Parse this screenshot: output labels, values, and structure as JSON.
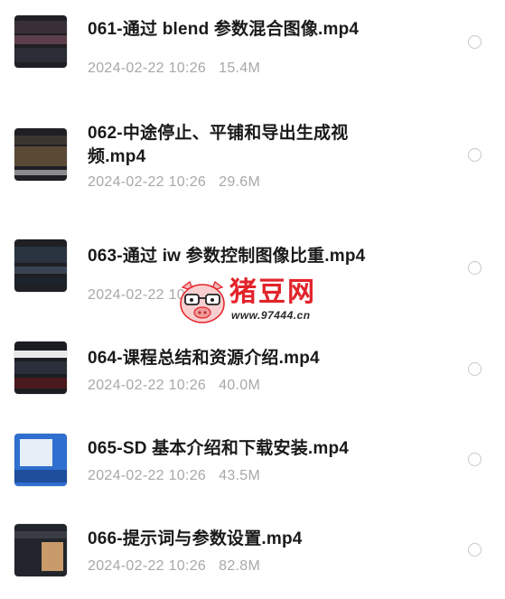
{
  "files": [
    {
      "name": "061-通过 blend 参数混合图像.mp4",
      "date": "2024-02-22 10:26",
      "size": "15.4M"
    },
    {
      "name": "062-中途停止、平铺和导出生成视频.mp4",
      "date": "2024-02-22 10:26",
      "size": "29.6M"
    },
    {
      "name": "063-通过 iw 参数控制图像比重.mp4",
      "date": "2024-02-22 10:26",
      "size": ""
    },
    {
      "name": "064-课程总结和资源介绍.mp4",
      "date": "2024-02-22 10:26",
      "size": "40.0M"
    },
    {
      "name": "065-SD 基本介绍和下载安装.mp4",
      "date": "2024-02-22 10:26",
      "size": "43.5M"
    },
    {
      "name": "066-提示词与参数设置.mp4",
      "date": "2024-02-22 10:26",
      "size": "82.8M"
    }
  ],
  "watermark": {
    "title": "猪豆网",
    "url": "www.97444.cn",
    "icon": "pig-logo-icon"
  },
  "colors": {
    "accent": "#e2232a",
    "meta_text": "#a8a8a8",
    "title_text": "#1a1a1a"
  }
}
